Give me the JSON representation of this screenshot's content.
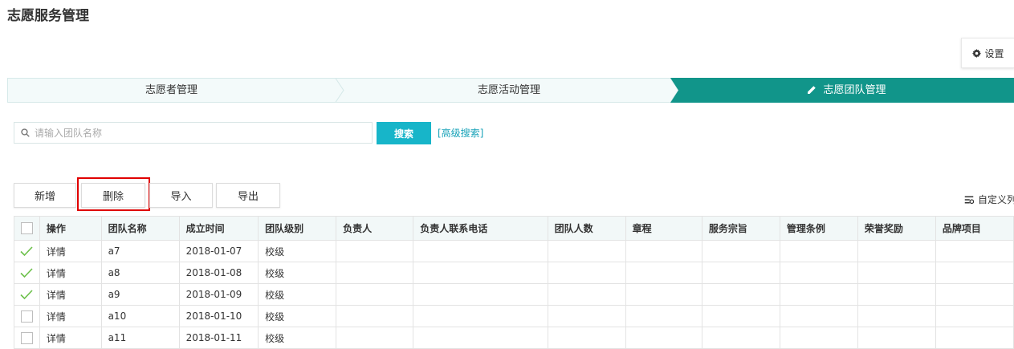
{
  "page": {
    "title": "志愿服务管理"
  },
  "toolbar_top": {
    "settings_label": "设置",
    "settings_icon": "gear-icon"
  },
  "steps": [
    {
      "label": "志愿者管理",
      "active": false
    },
    {
      "label": "志愿活动管理",
      "active": false
    },
    {
      "label": "志愿团队管理",
      "active": true,
      "icon": "pencil-icon"
    }
  ],
  "search": {
    "placeholder": "请输入团队名称",
    "value": "",
    "button_label": "搜索",
    "advanced_label": "[高级搜索]"
  },
  "actions": {
    "add": "新增",
    "delete": "删除",
    "import": "导入",
    "export": "导出"
  },
  "custom_columns_label": "自定义列",
  "table": {
    "headers": [
      "操作",
      "团队名称",
      "成立时间",
      "团队级别",
      "负责人",
      "负责人联系电话",
      "团队人数",
      "章程",
      "服务宗旨",
      "管理条例",
      "荣誉奖励",
      "品牌项目"
    ],
    "rows": [
      {
        "checked": true,
        "action": "详情",
        "name": "a7",
        "date": "2018-01-07",
        "level": "校级"
      },
      {
        "checked": true,
        "action": "详情",
        "name": "a8",
        "date": "2018-01-08",
        "level": "校级"
      },
      {
        "checked": true,
        "action": "详情",
        "name": "a9",
        "date": "2018-01-09",
        "level": "校级"
      },
      {
        "checked": false,
        "action": "详情",
        "name": "a10",
        "date": "2018-01-10",
        "level": "校级"
      },
      {
        "checked": false,
        "action": "详情",
        "name": "a11",
        "date": "2018-01-11",
        "level": "校级"
      }
    ]
  },
  "colors": {
    "accent": "#17b5c9",
    "active_step": "#11958a",
    "link": "#17a2b8",
    "check": "#6cc04a",
    "highlight": "#e00000"
  }
}
